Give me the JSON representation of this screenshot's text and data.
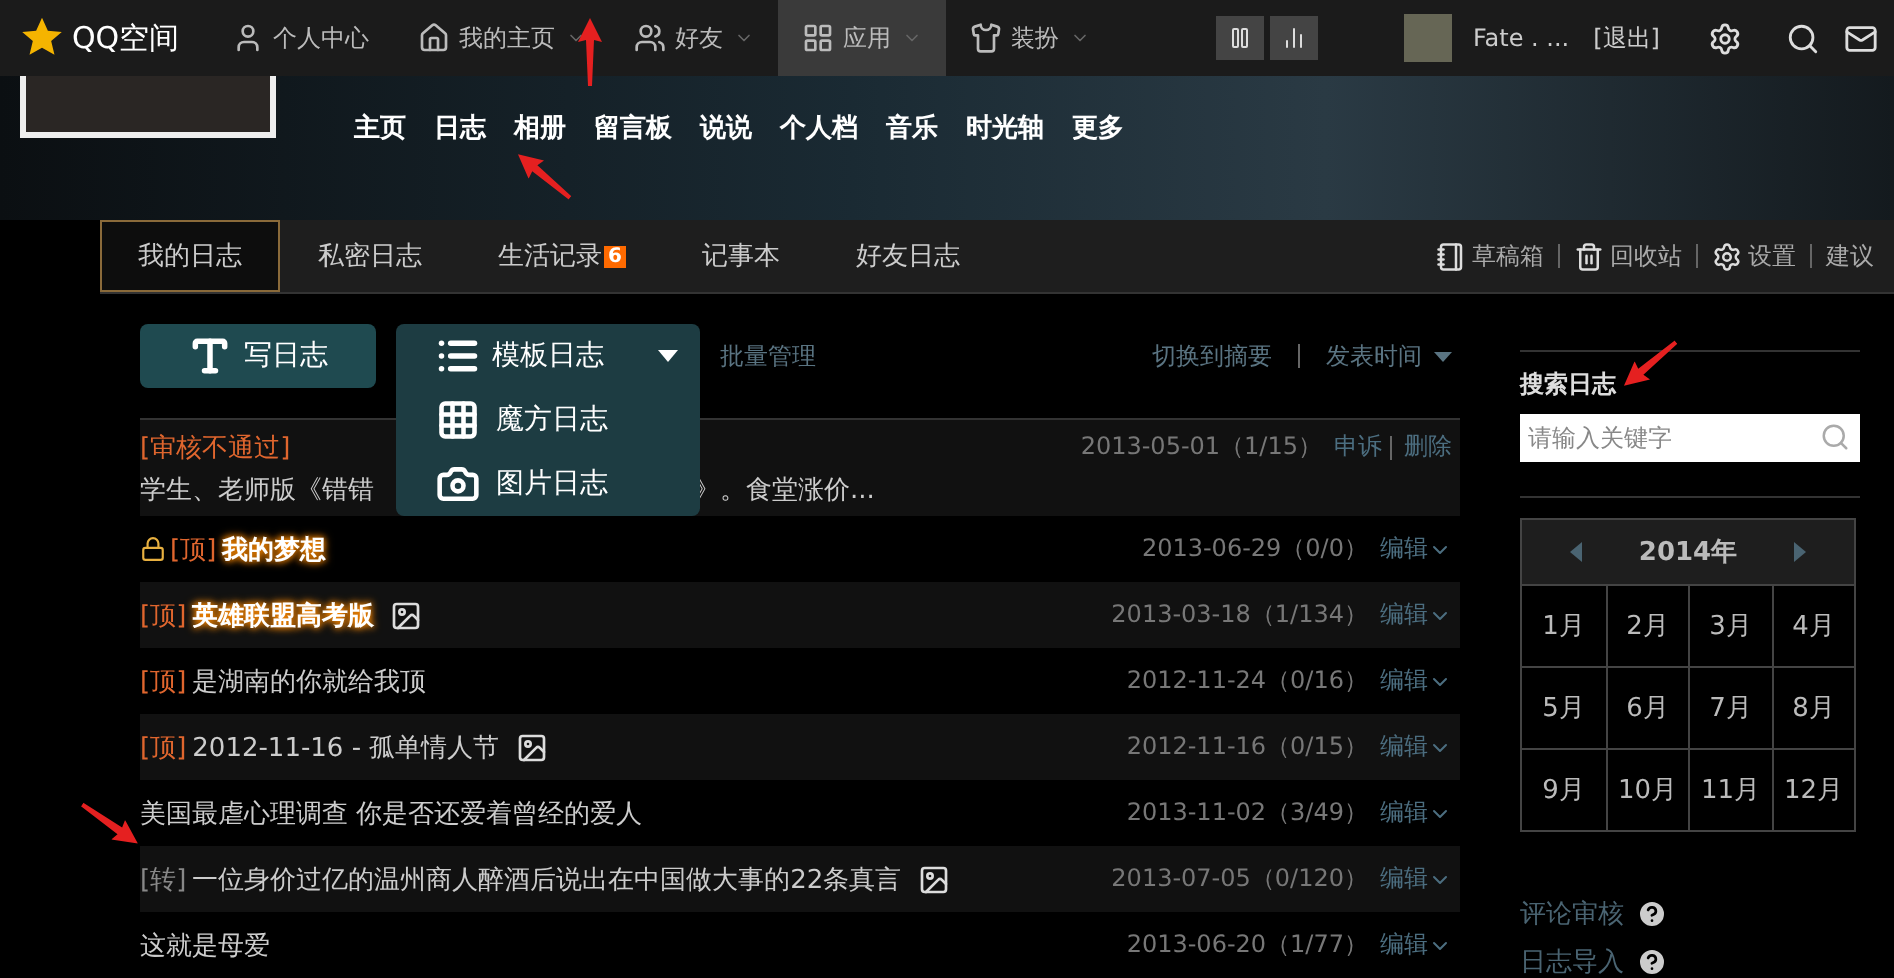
{
  "topbar": {
    "logo": "QQ空间",
    "nav": [
      {
        "label": "个人中心",
        "kind": "person",
        "caret": false,
        "selected": false
      },
      {
        "label": "我的主页",
        "kind": "home",
        "caret": true,
        "selected": false
      },
      {
        "label": "好友",
        "kind": "friends",
        "caret": true,
        "selected": false
      },
      {
        "label": "应用",
        "kind": "apps",
        "caret": true,
        "selected": true
      },
      {
        "label": "装扮",
        "kind": "shirt",
        "caret": true,
        "selected": false
      }
    ],
    "user": "Fate . ...",
    "logout": "[退出]"
  },
  "banner_nav": [
    "主页",
    "日志",
    "相册",
    "留言板",
    "说说",
    "个人档",
    "音乐",
    "时光轴",
    "更多"
  ],
  "tabs": [
    {
      "label": "我的日志",
      "selected": true
    },
    {
      "label": "私密日志",
      "selected": false
    },
    {
      "label": "生活记录",
      "selected": false,
      "badge": "6"
    },
    {
      "label": "记事本",
      "selected": false
    },
    {
      "label": "好友日志",
      "selected": false
    }
  ],
  "tools": [
    {
      "label": "草稿箱",
      "kind": "drafts"
    },
    {
      "label": "回收站",
      "kind": "trash"
    },
    {
      "label": "设置",
      "kind": "settings"
    },
    {
      "label": "建议",
      "kind": "plain"
    }
  ],
  "write_button": "写日志",
  "template_button": "模板日志",
  "template_menu": [
    {
      "label": "魔方日志",
      "kind": "grid"
    },
    {
      "label": "图片日志",
      "kind": "camera"
    }
  ],
  "batch": "批量管理",
  "switch_view": "切换到摘要",
  "sort": "发表时间",
  "posts": [
    {
      "kind": "review",
      "tag": {
        "kind": "review",
        "text": "[审核不通过]"
      },
      "date": "2013-05-01（1/15）",
      "actions": [
        "申诉",
        "删除"
      ],
      "title": "学生、老师版《错错",
      "title_tail": "》。食堂涨价..."
    },
    {
      "kind": "post",
      "lock": true,
      "tag": {
        "kind": "top",
        "text": "[顶]"
      },
      "title": "我的梦想",
      "highlight": true,
      "image": false,
      "date": "2013-06-29（0/0）",
      "action": "编辑"
    },
    {
      "kind": "post",
      "lock": false,
      "tag": {
        "kind": "top",
        "text": "[顶]"
      },
      "title": "英雄联盟高考版",
      "highlight": true,
      "image": true,
      "date": "2013-03-18（1/134）",
      "action": "编辑"
    },
    {
      "kind": "post",
      "lock": false,
      "tag": {
        "kind": "top",
        "text": "[顶]"
      },
      "title": "是湖南的你就给我顶",
      "highlight": false,
      "image": false,
      "date": "2012-11-24（0/16）",
      "action": "编辑"
    },
    {
      "kind": "post",
      "lock": false,
      "tag": {
        "kind": "top",
        "text": "[顶]"
      },
      "title": "2012-11-16 - 孤单情人节",
      "highlight": false,
      "image": true,
      "date": "2012-11-16（0/15）",
      "action": "编辑"
    },
    {
      "kind": "post",
      "lock": false,
      "title": "美国最虐心理调查 你是否还爱着曾经的爱人",
      "highlight": false,
      "image": false,
      "date": "2013-11-02（3/49）",
      "action": "编辑"
    },
    {
      "kind": "post",
      "lock": false,
      "tag": {
        "kind": "repost",
        "text": "[转]"
      },
      "title": "一位身价过亿的温州商人醉酒后说出在中国做大事的22条真言",
      "highlight": false,
      "image": true,
      "date": "2013-07-05（0/120）",
      "action": "编辑"
    },
    {
      "kind": "post",
      "lock": false,
      "title": "这就是母爱",
      "highlight": false,
      "image": false,
      "date": "2013-06-20（1/77）",
      "action": "编辑"
    }
  ],
  "sidebar": {
    "search_label": "搜索日志",
    "search_placeholder": "请输入关键字",
    "year": "2014年",
    "months": [
      "1月",
      "2月",
      "3月",
      "4月",
      "5月",
      "6月",
      "7月",
      "8月",
      "9月",
      "10月",
      "11月",
      "12月"
    ],
    "links": [
      "评论审核",
      "日志导入"
    ]
  }
}
